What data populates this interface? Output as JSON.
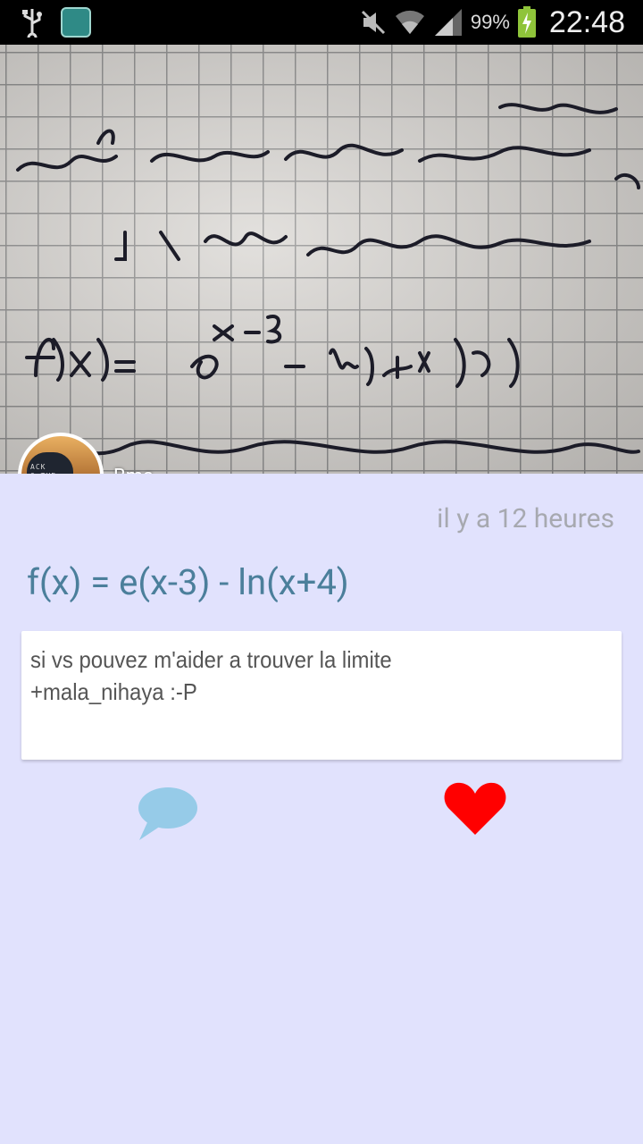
{
  "status_bar": {
    "battery_percent": "99%",
    "time": "22:48",
    "icons": [
      "usb-icon",
      "app-notification-icon",
      "mute-icon",
      "wifi-icon",
      "signal-icon",
      "battery-charging-icon"
    ]
  },
  "post": {
    "author": "Bma...",
    "timestamp": "il y a 12 heures",
    "title": "f(x) = e(x-3) - ln(x+4)",
    "body_lines": [
      "si vs pouvez m'aider a trouver la limite",
      "+mala_nihaya :-P"
    ],
    "avatar_text": "ACK\nO THE\nUTURE"
  },
  "actions": {
    "comment_icon": "speech-bubble-icon",
    "like_icon": "heart-icon",
    "comment_color": "#96cbe8",
    "like_color": "#ff0000"
  },
  "colors": {
    "background": "#e1e2fd",
    "title": "#4b7f9b",
    "timestamp": "#a7a9b0"
  }
}
